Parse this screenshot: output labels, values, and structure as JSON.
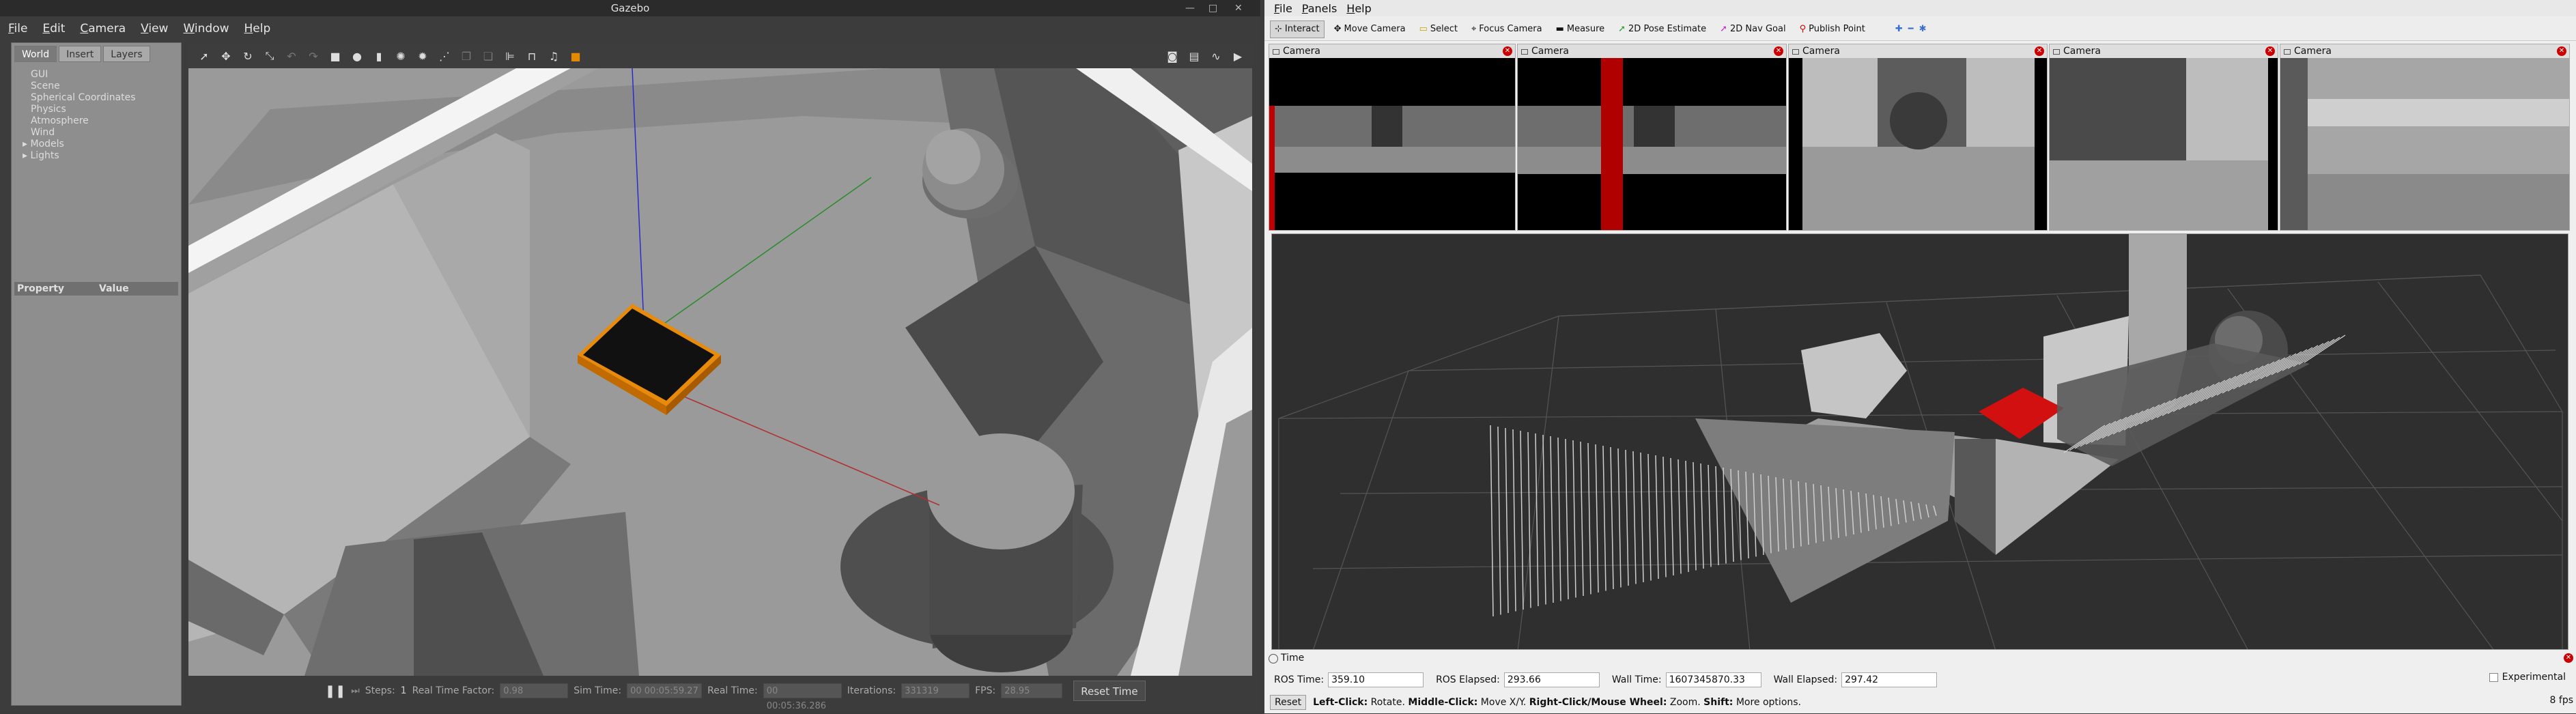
{
  "gazebo": {
    "title": "Gazebo",
    "menu": [
      "File",
      "Edit",
      "Camera",
      "View",
      "Window",
      "Help"
    ],
    "tabs": [
      "World",
      "Insert",
      "Layers"
    ],
    "tree": {
      "items": [
        "GUI",
        "Scene",
        "Spherical Coordinates",
        "Physics",
        "Atmosphere",
        "Wind"
      ],
      "expandable": [
        "Models",
        "Lights"
      ]
    },
    "property_header": [
      "Property",
      "Value"
    ],
    "bottom": {
      "steps_label": "Steps:",
      "steps_value": "1",
      "rtf_label": "Real Time Factor:",
      "rtf_value": "0.98",
      "sim_label": "Sim Time:",
      "sim_value": "00 00:05:59.27",
      "real_label": "Real Time:",
      "real_value": "00 00:05:36.286",
      "iter_label": "Iterations:",
      "iter_value": "331319",
      "fps_label": "FPS:",
      "fps_value": "28.95",
      "reset_label": "Reset Time"
    }
  },
  "rviz": {
    "menu": [
      "File",
      "Panels",
      "Help"
    ],
    "tools": [
      "Interact",
      "Move Camera",
      "Select",
      "Focus Camera",
      "Measure",
      "2D Pose Estimate",
      "2D Nav Goal",
      "Publish Point"
    ],
    "camera_title": "Camera",
    "time": {
      "title": "Time",
      "ros_time_label": "ROS Time:",
      "ros_time": "359.10",
      "ros_elapsed_label": "ROS Elapsed:",
      "ros_elapsed": "293.66",
      "wall_time_label": "Wall Time:",
      "wall_time": "1607345870.33",
      "wall_elapsed_label": "Wall Elapsed:",
      "wall_elapsed": "297.42",
      "experimental": "Experimental"
    },
    "reset": "Reset",
    "hint": {
      "b1": "Left-Click:",
      "t1": " Rotate. ",
      "b2": "Middle-Click:",
      "t2": " Move X/Y. ",
      "b3": "Right-Click/Mouse Wheel:",
      "t3": " Zoom. ",
      "b4": "Shift:",
      "t4": " More options."
    },
    "fps": "8 fps"
  },
  "colors": {
    "robot": "#e88a0a",
    "scan": "#c00000"
  }
}
